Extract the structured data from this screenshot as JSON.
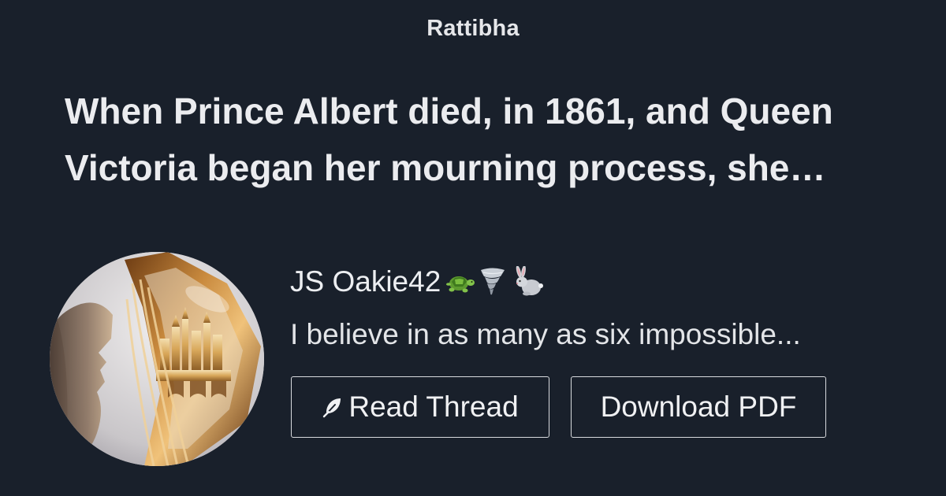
{
  "brand": {
    "name": "Rattibha"
  },
  "thread": {
    "title_line1": "When Prince Albert died, in 1861, and Queen",
    "title_line2": "Victoria began her mourning process, she…"
  },
  "author": {
    "name": "JS Oakie42",
    "emoji_icons": [
      "turtle-icon",
      "tornado-icon",
      "rabbit-icon"
    ],
    "bio": "I believe in as many as six impossible..."
  },
  "actions": {
    "read_label": "Read Thread",
    "read_icon": "feather-icon",
    "pdf_label": "Download PDF"
  },
  "colors": {
    "background": "#19202b",
    "text": "#ebecef",
    "button_border": "#d8dade"
  }
}
